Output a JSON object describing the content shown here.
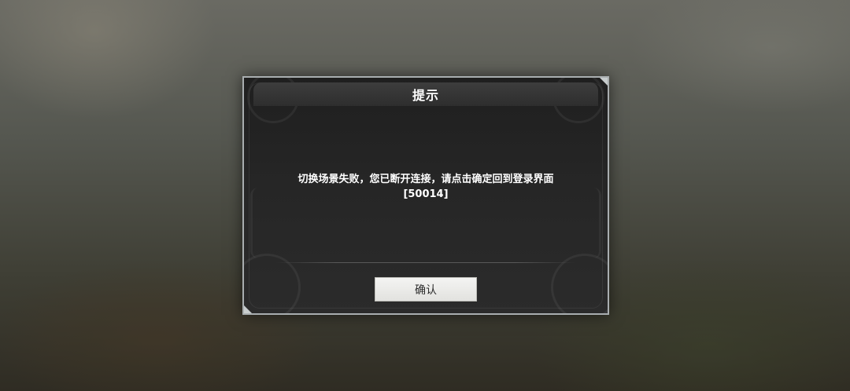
{
  "dialog": {
    "title": "提示",
    "message_line1": "切换场景失败，您已断开连接，请点击确定回到登录界面",
    "message_line2": "[50014]",
    "confirm_label": "确认"
  },
  "colors": {
    "dialog_border": "#a9aeb0",
    "dialog_bg": "#262626",
    "button_bg": "#eeeeec",
    "text": "#ffffff"
  }
}
